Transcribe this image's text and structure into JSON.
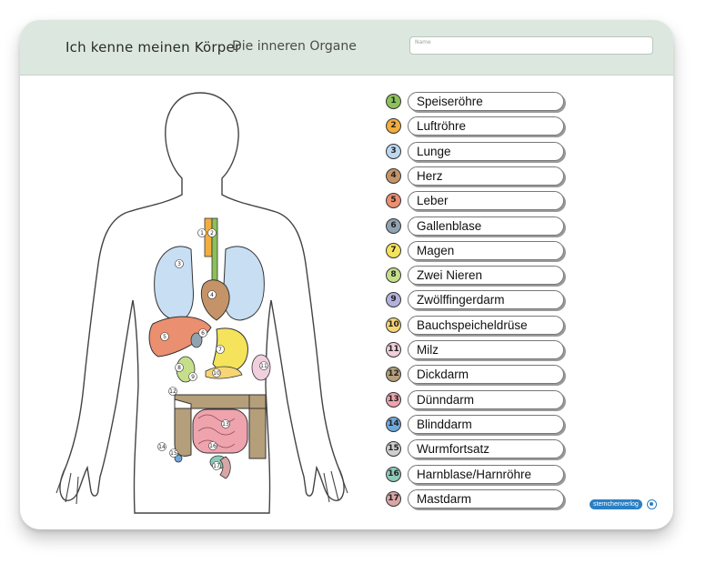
{
  "header": {
    "title": "Ich kenne meinen Körper",
    "subtitle": "Die inneren Organe",
    "name_placeholder": "Name"
  },
  "organs": [
    {
      "num": "1",
      "label": "Speiseröhre",
      "color": "#8cc05a"
    },
    {
      "num": "2",
      "label": "Luftröhre",
      "color": "#f2ad3c"
    },
    {
      "num": "3",
      "label": "Lunge",
      "color": "#bcd7ef"
    },
    {
      "num": "4",
      "label": "Herz",
      "color": "#c49468"
    },
    {
      "num": "5",
      "label": "Leber",
      "color": "#ea8f6f"
    },
    {
      "num": "6",
      "label": "Gallenblase",
      "color": "#8fa3b0"
    },
    {
      "num": "7",
      "label": "Magen",
      "color": "#f4e35b"
    },
    {
      "num": "8",
      "label": "Zwei Nieren",
      "color": "#c5de8a"
    },
    {
      "num": "9",
      "label": "Zwölffingerdarm",
      "color": "#b3b1dc"
    },
    {
      "num": "10",
      "label": "Bauchspeicheldrüse",
      "color": "#f5d576"
    },
    {
      "num": "11",
      "label": "Milz",
      "color": "#f1cfdc"
    },
    {
      "num": "12",
      "label": "Dickdarm",
      "color": "#b59e7a"
    },
    {
      "num": "13",
      "label": "Dünndarm",
      "color": "#eea3ad"
    },
    {
      "num": "14",
      "label": "Blinddarm",
      "color": "#6fa8dc"
    },
    {
      "num": "15",
      "label": "Wurmfortsatz",
      "color": "#cfcfcf"
    },
    {
      "num": "16",
      "label": "Harnblase/Harnröhre",
      "color": "#8ecab8"
    },
    {
      "num": "17",
      "label": "Mastdarm",
      "color": "#d9a6a6"
    }
  ],
  "publisher": "sternchenverlog"
}
